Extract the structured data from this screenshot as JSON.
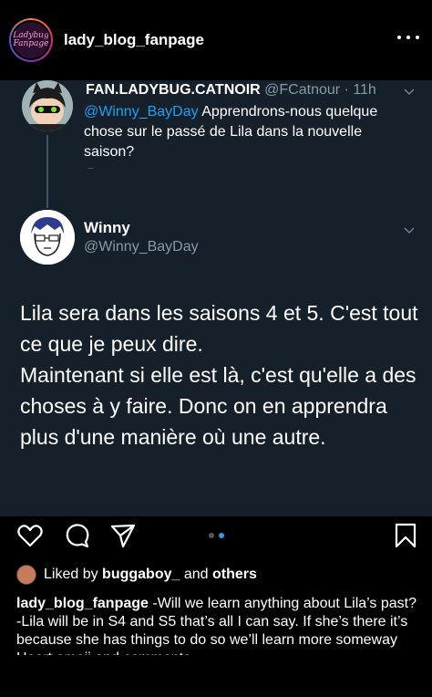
{
  "post": {
    "username": "lady_blog_fanpage",
    "avatar_text": "Ladybug Fanpage"
  },
  "tweet": {
    "quoted": {
      "name": "FAN.LADYBUG.CATNOIR",
      "handle": "@FCatnour",
      "time": "11h",
      "mention": "@Winny_BayDay",
      "text": " Apprendrons-nous quelque chose sur le passé de Lila dans la nouvelle saison?"
    },
    "reply": {
      "name": "Winny",
      "handle": "@Winny_BayDay",
      "text": "Lila sera dans les saisons 4 et 5. C'est tout ce que je peux dire.\nMaintenant si elle est là, c'est qu'elle a des choses à y faire. Donc on en apprendra plus d'une manière où une autre."
    }
  },
  "actions": {
    "icons": [
      "heart-icon",
      "comment-icon",
      "share-icon",
      "bookmark-icon"
    ],
    "carousel": {
      "count": 2,
      "active": 2,
      "active_color": "#3897f0",
      "inactive_color": "#555555"
    }
  },
  "likes": {
    "prefix": "Liked by",
    "user": "buggaboy_",
    "suffix": "and",
    "others": "others"
  },
  "caption": {
    "author": "lady_blog_fanpage",
    "line1": " -Will we learn anything about Lila’s past?",
    "line2": "-Lila will be in S4 and S5 that’s all I can say. If she’s there it’s because she has things to do so we’ll learn more someway",
    "line3": "Heart emoji and comments"
  },
  "colors": {
    "tweet_bg": "#15202b",
    "mention": "#1da1f2",
    "muted": "#8899a6"
  }
}
